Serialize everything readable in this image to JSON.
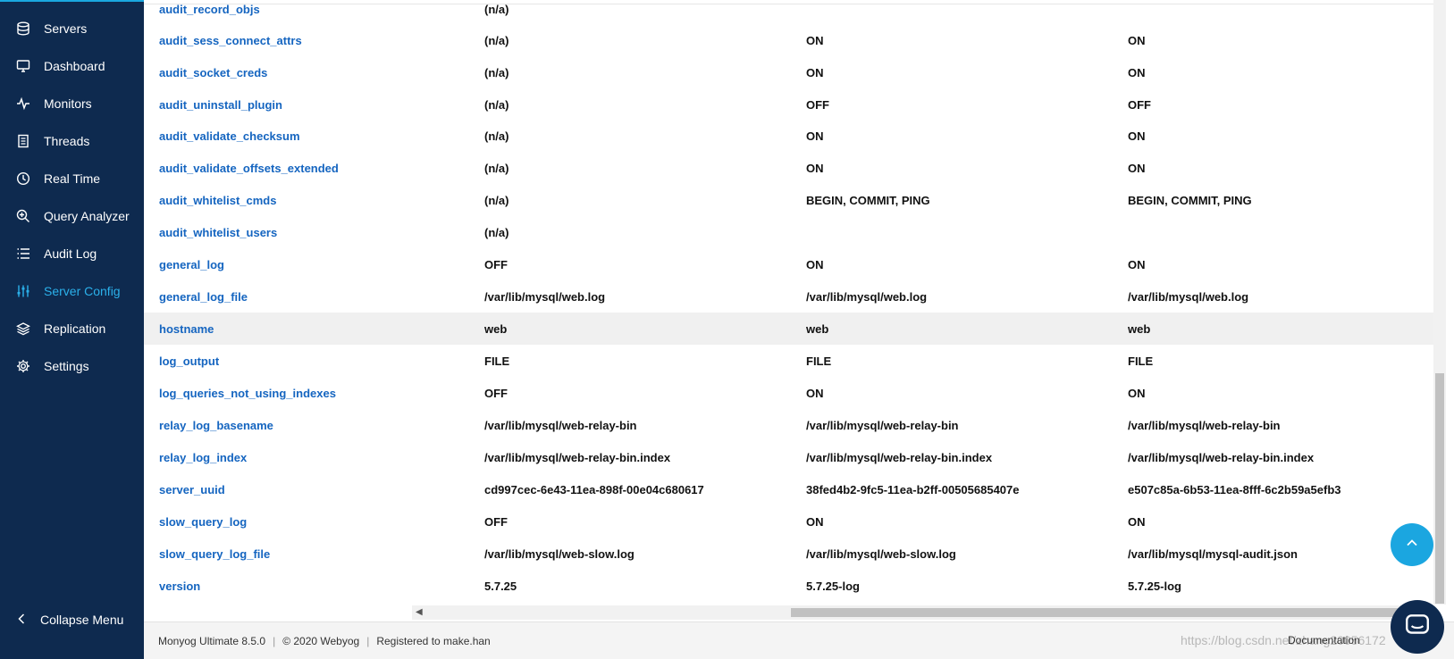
{
  "sidebar": {
    "items": [
      {
        "label": "Servers",
        "icon": "database-icon"
      },
      {
        "label": "Dashboard",
        "icon": "monitor-icon"
      },
      {
        "label": "Monitors",
        "icon": "pulse-icon"
      },
      {
        "label": "Threads",
        "icon": "document-icon"
      },
      {
        "label": "Real Time",
        "icon": "clock-icon"
      },
      {
        "label": "Query Analyzer",
        "icon": "zoom-icon"
      },
      {
        "label": "Audit Log",
        "icon": "list-icon"
      },
      {
        "label": "Server Config",
        "icon": "sliders-icon",
        "active": true
      },
      {
        "label": "Replication",
        "icon": "layers-icon"
      },
      {
        "label": "Settings",
        "icon": "gear-icon"
      }
    ],
    "collapse_label": "Collapse Menu",
    "active_color": "#2bb0ea",
    "background": "#0e2a4f"
  },
  "table": {
    "partial_row": {
      "name": "audit_record_objs",
      "v1": "(n/a)",
      "v2": "",
      "v3": ""
    },
    "rows": [
      {
        "name": "audit_sess_connect_attrs",
        "v1": "(n/a)",
        "v2": "ON",
        "v3": "ON"
      },
      {
        "name": "audit_socket_creds",
        "v1": "(n/a)",
        "v2": "ON",
        "v3": "ON"
      },
      {
        "name": "audit_uninstall_plugin",
        "v1": "(n/a)",
        "v2": "OFF",
        "v3": "OFF"
      },
      {
        "name": "audit_validate_checksum",
        "v1": "(n/a)",
        "v2": "ON",
        "v3": "ON"
      },
      {
        "name": "audit_validate_offsets_extended",
        "v1": "(n/a)",
        "v2": "ON",
        "v3": "ON"
      },
      {
        "name": "audit_whitelist_cmds",
        "v1": "(n/a)",
        "v2": "BEGIN, COMMIT, PING",
        "v3": "BEGIN, COMMIT, PING"
      },
      {
        "name": "audit_whitelist_users",
        "v1": "(n/a)",
        "v2": "",
        "v3": ""
      },
      {
        "name": "general_log",
        "v1": "OFF",
        "v2": "ON",
        "v3": "ON"
      },
      {
        "name": "general_log_file",
        "v1": "/var/lib/mysql/web.log",
        "v2": "/var/lib/mysql/web.log",
        "v3": "/var/lib/mysql/web.log"
      },
      {
        "name": "hostname",
        "v1": "web",
        "v2": "web",
        "v3": "web",
        "highlight": true
      },
      {
        "name": "log_output",
        "v1": "FILE",
        "v2": "FILE",
        "v3": "FILE"
      },
      {
        "name": "log_queries_not_using_indexes",
        "v1": "OFF",
        "v2": "ON",
        "v3": "ON"
      },
      {
        "name": "relay_log_basename",
        "v1": "/var/lib/mysql/web-relay-bin",
        "v2": "/var/lib/mysql/web-relay-bin",
        "v3": "/var/lib/mysql/web-relay-bin"
      },
      {
        "name": "relay_log_index",
        "v1": "/var/lib/mysql/web-relay-bin.index",
        "v2": "/var/lib/mysql/web-relay-bin.index",
        "v3": "/var/lib/mysql/web-relay-bin.index"
      },
      {
        "name": "server_uuid",
        "v1": "cd997cec-6e43-11ea-898f-00e04c680617",
        "v2": "38fed4b2-9fc5-11ea-b2ff-00505685407e",
        "v3": "e507c85a-6b53-11ea-8fff-6c2b59a5efb3"
      },
      {
        "name": "slow_query_log",
        "v1": "OFF",
        "v2": "ON",
        "v3": "ON"
      },
      {
        "name": "slow_query_log_file",
        "v1": "/var/lib/mysql/web-slow.log",
        "v2": "/var/lib/mysql/web-slow.log",
        "v3": "/var/lib/mysql/mysql-audit.json"
      },
      {
        "name": "version",
        "v1": "5.7.25",
        "v2": "5.7.25-log",
        "v3": "5.7.25-log"
      }
    ],
    "name_color": "#1565c0",
    "highlight_color": "#f0f0f0"
  },
  "footer": {
    "product": "Monyog Ultimate 8.5.0",
    "copyright": "©  2020 Webyog",
    "registered": "Registered to make.han",
    "documentation": "Documentation",
    "watermark": "https://blog.csdn.net/zhang20056172"
  },
  "buttons": {
    "scroll_top_icon": "chevron-up-icon",
    "chat_icon": "chat-icon",
    "accent": "#1ba6e0"
  }
}
